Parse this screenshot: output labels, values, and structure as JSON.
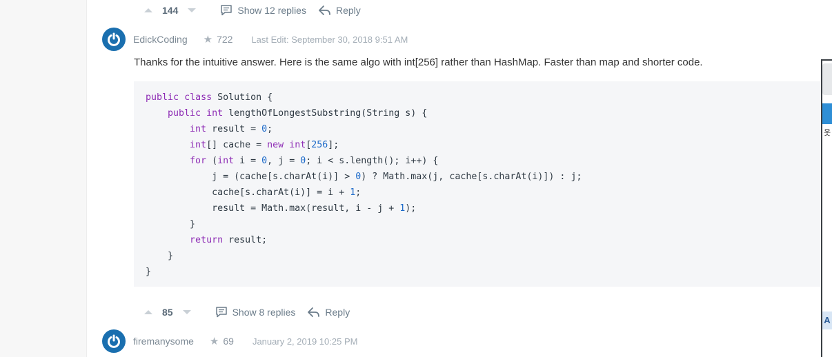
{
  "top_actions": {
    "vote_count": "144",
    "show_replies_label": "Show 12 replies",
    "reply_label": "Reply"
  },
  "post": {
    "author": "EdickCoding",
    "reputation": "722",
    "timestamp": "Last Edit: September 30, 2018 9:51 AM",
    "text": "Thanks for the intuitive answer. Here is the same algo with int[256] rather than HashMap. Faster than map and shorter code.",
    "code_lines": [
      "public class Solution {",
      "    public int lengthOfLongestSubstring(String s) {",
      "        int result = 0;",
      "        int[] cache = new int[256];",
      "        for (int i = 0, j = 0; i < s.length(); i++) {",
      "            j = (cache[s.charAt(i)] > 0) ? Math.max(j, cache[s.charAt(i)]) : j;",
      "            cache[s.charAt(i)] = i + 1;",
      "            result = Math.max(result, i - j + 1);",
      "        }",
      "        return result;",
      "    }",
      "}"
    ],
    "vote_count": "85",
    "show_replies_label": "Show 8 replies",
    "reply_label": "Reply"
  },
  "next_post": {
    "author": "firemanysome",
    "reputation": "69",
    "timestamp": "January 2, 2019 10:25 PM"
  },
  "side_widget": {
    "char": "웃",
    "button_label": "A"
  },
  "colors": {
    "avatar_blue": "#1a6faf",
    "keyword_purple": "#8e2db5",
    "number_blue": "#1b69c9",
    "code_bg": "#f5f6f8"
  }
}
